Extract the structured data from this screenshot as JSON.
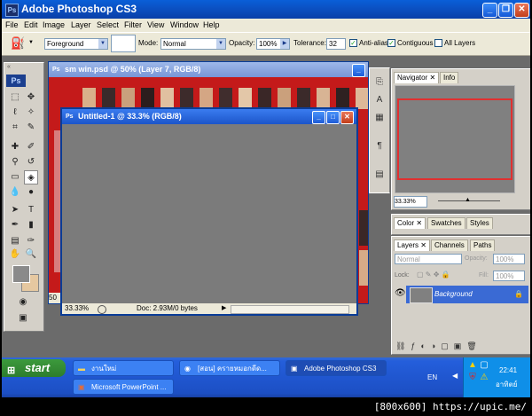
{
  "app": {
    "title": "Adobe Photoshop CS3",
    "ps_badge": "Ps"
  },
  "menu": [
    "File",
    "Edit",
    "Image",
    "Layer",
    "Select",
    "Filter",
    "View",
    "Window",
    "Help"
  ],
  "options": {
    "preset": "Foreground",
    "mode_label": "Mode:",
    "mode": "Normal",
    "opacity_label": "Opacity:",
    "opacity": "100%",
    "tolerance_label": "Tolerance:",
    "tolerance": "32",
    "anti_alias": "Anti-alias",
    "contiguous": "Contiguous",
    "all_layers": "All Layers"
  },
  "toolbox": {
    "badge": "Ps"
  },
  "doc_back": {
    "title": "sm win.psd @ 50% (Layer 7, RGB/8)",
    "zoom": "50"
  },
  "doc_front": {
    "title": "Untitled-1 @ 33.3% (RGB/8)",
    "zoom": "33.33%",
    "doc_info": "Doc: 2.93M/0 bytes"
  },
  "navigator": {
    "tab_nav": "Navigator",
    "tab_info": "Info",
    "zoom": "33.33%"
  },
  "color_panel": {
    "tab_color": "Color",
    "tab_swatches": "Swatches",
    "tab_styles": "Styles"
  },
  "layers": {
    "tab_layers": "Layers",
    "tab_channels": "Channels",
    "tab_paths": "Paths",
    "blend": "Normal",
    "opacity_label": "Opacity:",
    "opacity": "100%",
    "lock_label": "Lock:",
    "fill_label": "Fill:",
    "fill": "100%",
    "layer_name": "Background"
  },
  "taskbar": {
    "start": "start",
    "btn_folder": "งานใหม่",
    "btn_chrome": "[สอน] ครายหมอกดีด...",
    "btn_photoshop": "Adobe Photoshop CS3",
    "btn_ppt": "Microsoft PowerPoint ...",
    "lang": "EN",
    "time": "22:41",
    "day": "อาทิตย์"
  },
  "caption": "[800x600] https://upic.me/",
  "colors": {
    "accent": "#245edb",
    "red_canvas": "#c41a1a",
    "layer_selected": "#3a6ad4"
  }
}
